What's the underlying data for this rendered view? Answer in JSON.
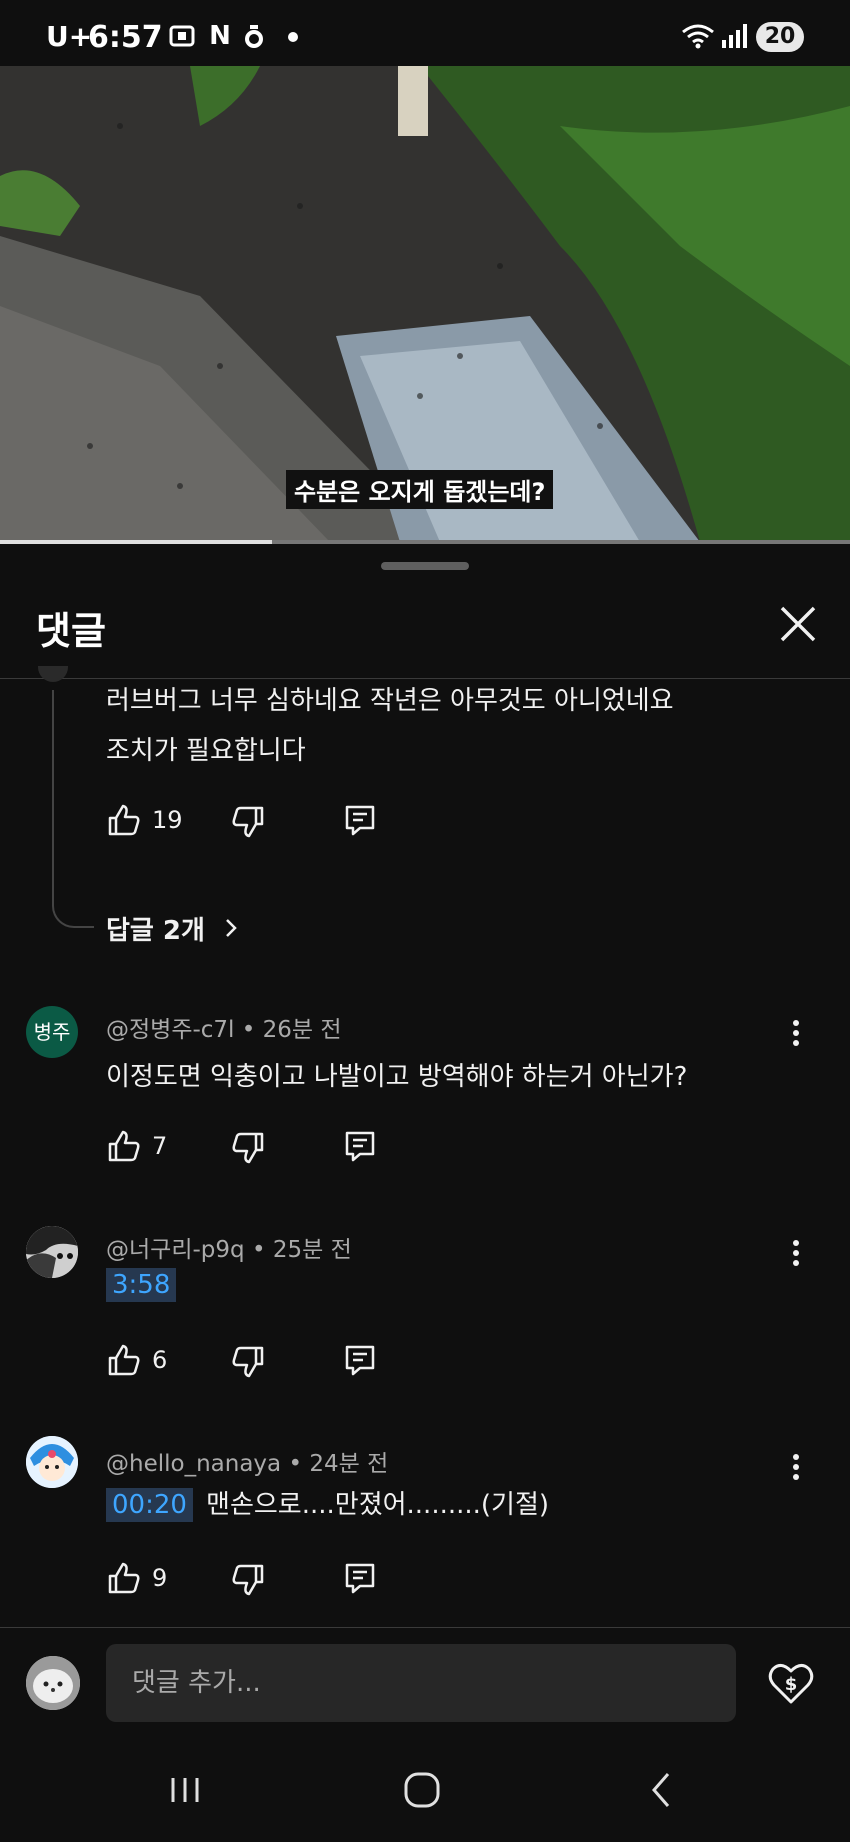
{
  "status_bar": {
    "carrier": "U+",
    "time": "6:57",
    "notification_letter": "N",
    "battery": "20"
  },
  "video": {
    "caption": "수분은 오지게 돕겠는데?",
    "progress": 0.32
  },
  "comments_panel": {
    "title": "댓글",
    "partial_comment": {
      "text_line1": "러브버그 너무 심하네요 작년은 아무것도 아니었네요",
      "text_line2": "조치가 필요합니다",
      "likes": "19",
      "replies_label": "답글 2개"
    },
    "comments": [
      {
        "avatar_text": "병주",
        "avatar_color": "#0b5a45",
        "author": "@정병주-c7l",
        "time": "26분 전",
        "text": "이정도면 익충이고 나발이고 방역해야 하는거 아닌가?",
        "likes": "7"
      },
      {
        "avatar_type": "cat-photo",
        "author": "@너구리-p9q",
        "time": "25분 전",
        "timestamp": "3:58",
        "text": "",
        "likes": "6"
      },
      {
        "avatar_type": "cartoon",
        "author": "@hello_nanaya",
        "time": "24분 전",
        "timestamp": "00:20",
        "text": "맨손으로....만졌어.........(기절)",
        "likes": "9"
      }
    ],
    "input_placeholder": "댓글 추가...",
    "colors": {
      "background": "#0f0f0f",
      "input_bg": "#272727",
      "timestamp_link": "#3ea6ff"
    }
  }
}
